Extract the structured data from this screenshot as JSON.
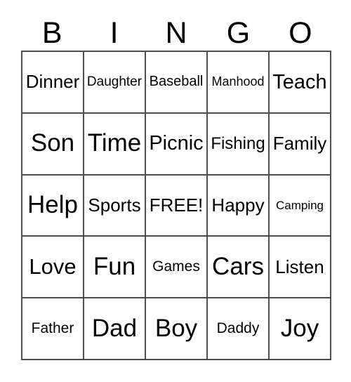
{
  "card": {
    "type": "bingo-card",
    "theme_colors": {
      "background": "#ffffff",
      "text": "#000000",
      "grid_line": "#4d4d4d"
    },
    "header": {
      "letters": [
        "B",
        "I",
        "N",
        "G",
        "O"
      ]
    },
    "grid": {
      "columns": 5,
      "rows": 5,
      "free_space": {
        "row": 3,
        "column": 3,
        "label": "FREE!"
      },
      "cells": [
        [
          {
            "label": "Dinner",
            "size": "lg"
          },
          {
            "label": "Daughter",
            "size": "sm"
          },
          {
            "label": "Baseball",
            "size": "sm"
          },
          {
            "label": "Manhood",
            "size": "sm"
          },
          {
            "label": "Teach",
            "size": "lg"
          }
        ],
        [
          {
            "label": "Son",
            "size": "xl"
          },
          {
            "label": "Time",
            "size": "xl"
          },
          {
            "label": "Picnic",
            "size": "lg"
          },
          {
            "label": "Fishing",
            "size": "md"
          },
          {
            "label": "Family",
            "size": "md"
          }
        ],
        [
          {
            "label": "Help",
            "size": "xl"
          },
          {
            "label": "Sports",
            "size": "md"
          },
          {
            "label": "FREE!",
            "size": "lg"
          },
          {
            "label": "Happy",
            "size": "md"
          },
          {
            "label": "Camping",
            "size": "xs"
          }
        ],
        [
          {
            "label": "Love",
            "size": "lg"
          },
          {
            "label": "Fun",
            "size": "xl"
          },
          {
            "label": "Games",
            "size": "sm"
          },
          {
            "label": "Cars",
            "size": "xl"
          },
          {
            "label": "Listen",
            "size": "md"
          }
        ],
        [
          {
            "label": "Father",
            "size": "sm"
          },
          {
            "label": "Dad",
            "size": "xl"
          },
          {
            "label": "Boy",
            "size": "xl"
          },
          {
            "label": "Daddy",
            "size": "sm"
          },
          {
            "label": "Joy",
            "size": "xl"
          }
        ]
      ]
    }
  }
}
